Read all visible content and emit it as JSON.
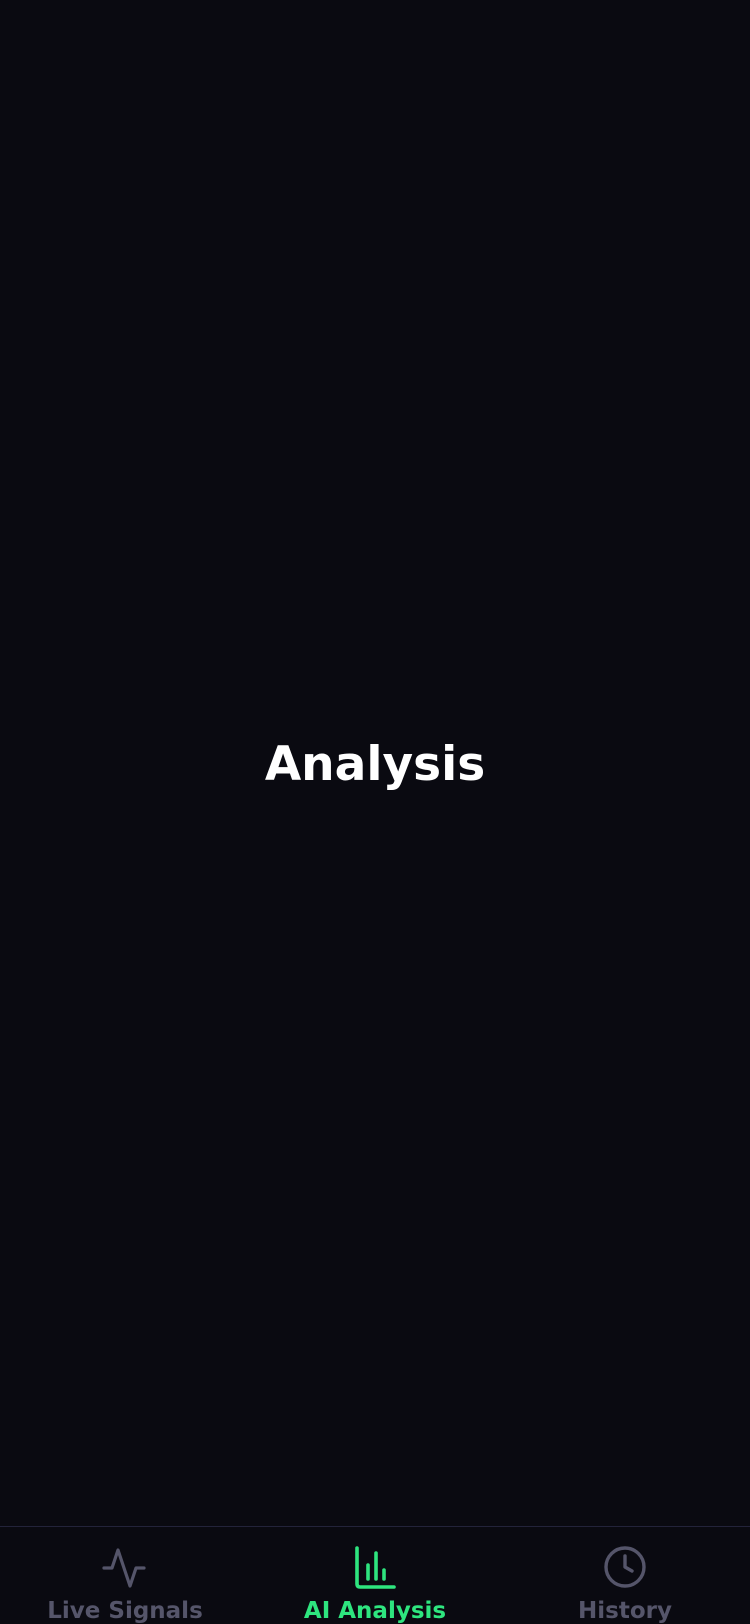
{
  "main": {
    "title": "Analysis"
  },
  "tab_bar": {
    "active_color": "#2ee57f",
    "inactive_color": "#55556a",
    "tabs": [
      {
        "label": "Live Signals",
        "icon": "activity-icon",
        "active": false
      },
      {
        "label": "AI Analysis",
        "icon": "bar-chart-icon",
        "active": true
      },
      {
        "label": "History",
        "icon": "clock-icon",
        "active": false
      }
    ]
  }
}
